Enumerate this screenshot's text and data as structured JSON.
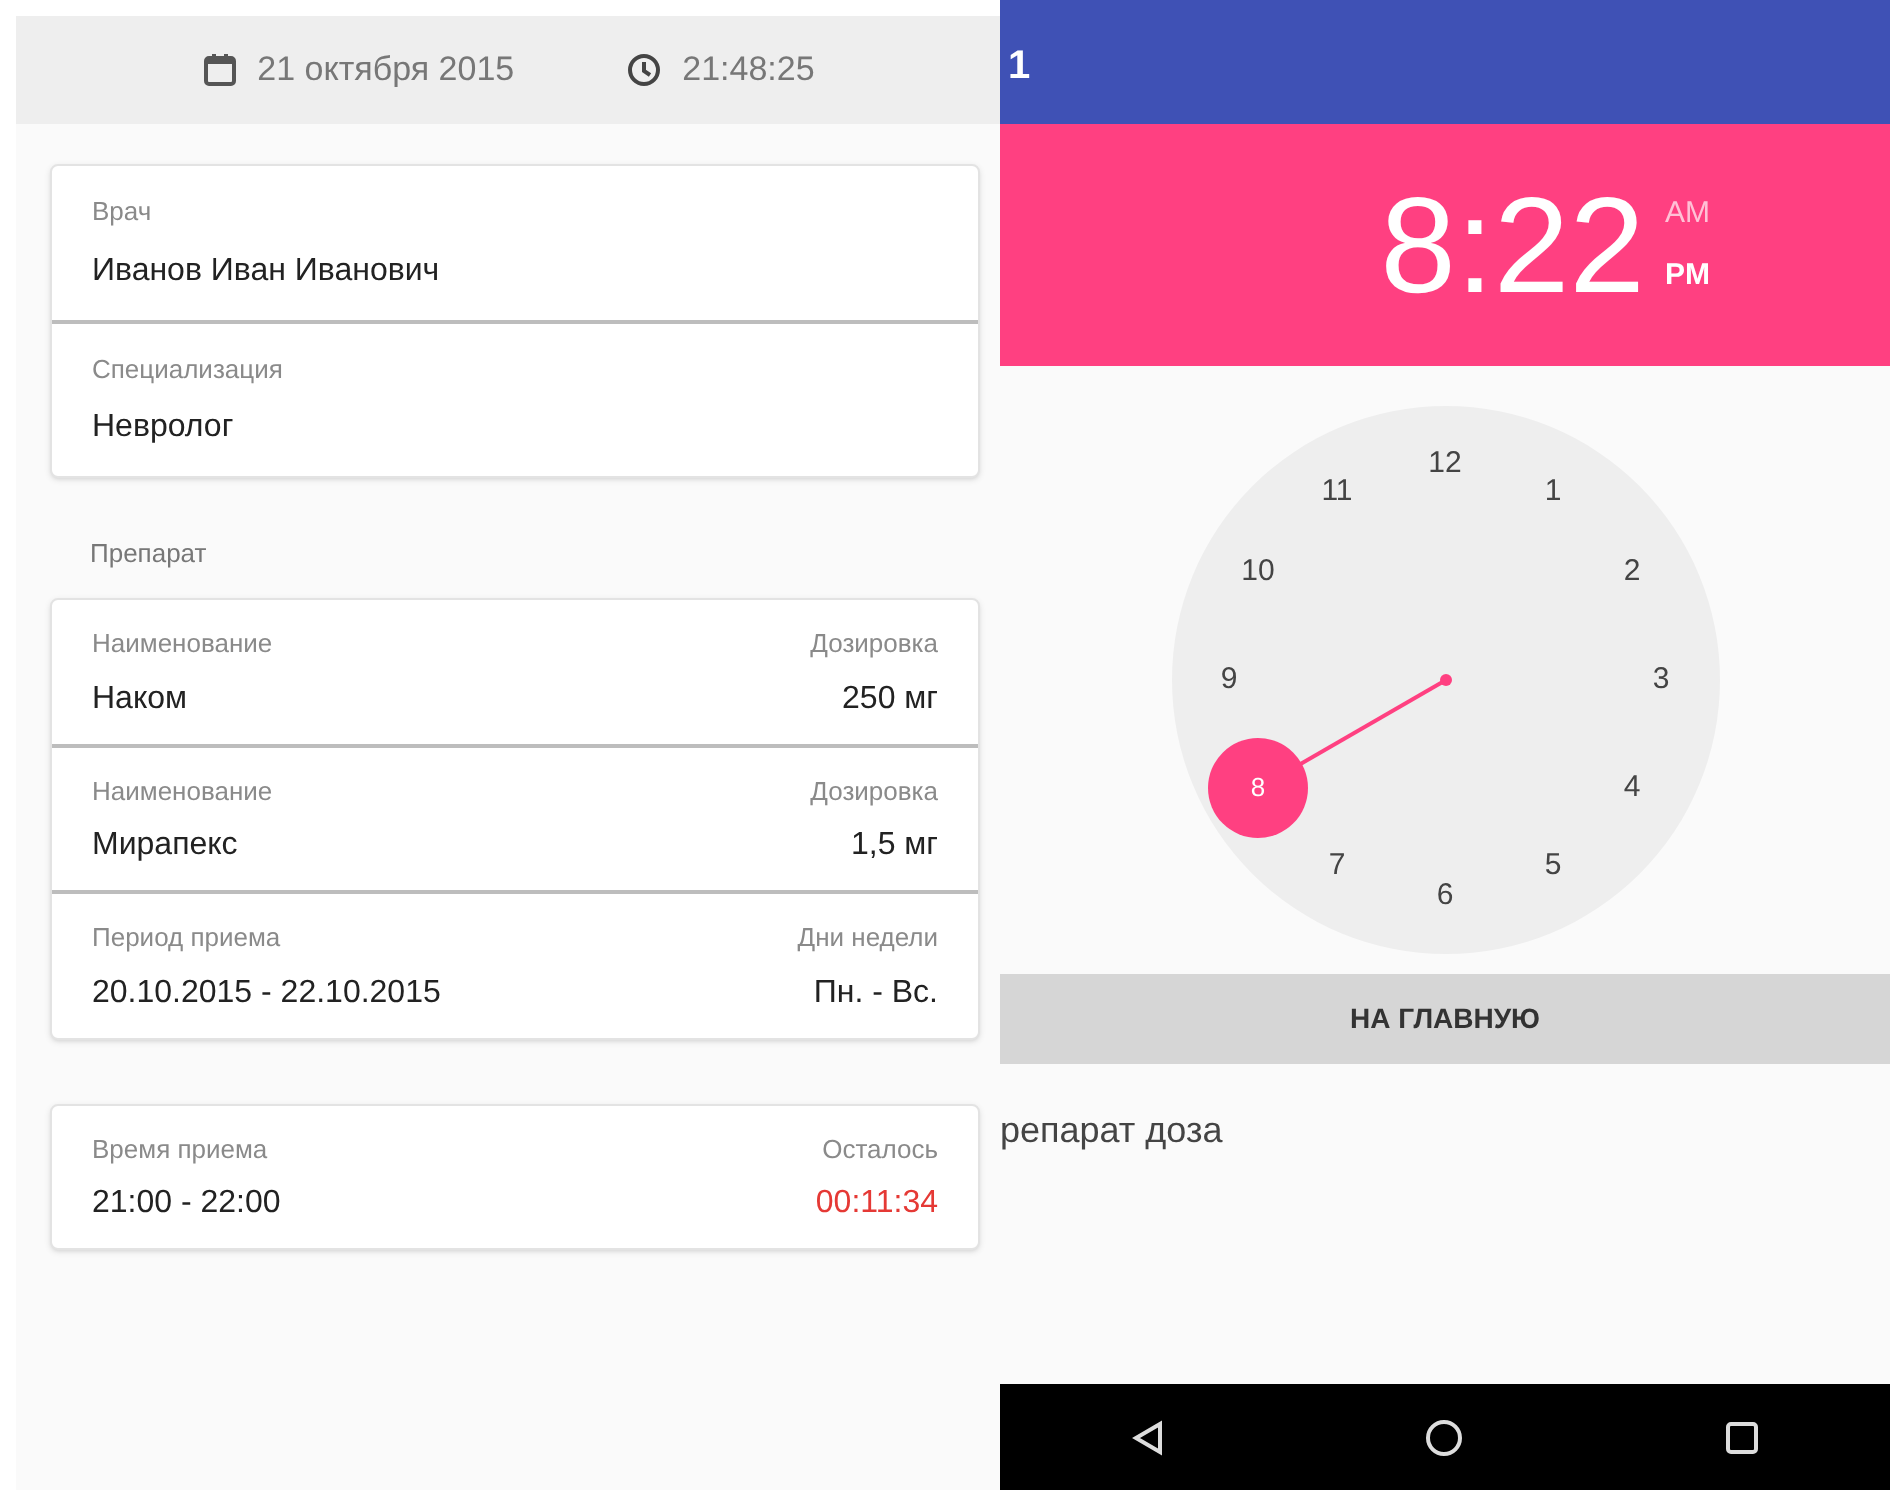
{
  "header": {
    "date": "21 октября 2015",
    "time": "21:48:25"
  },
  "doctor_card": {
    "fields": [
      {
        "label": "Врач",
        "value": "Иванов Иван Иванович"
      },
      {
        "label": "Специализация",
        "value": "Невролог"
      }
    ]
  },
  "drug_section": {
    "title": "Препарат",
    "rows": [
      {
        "left_label": "Наименование",
        "left_value": "Наком",
        "right_label": "Дозировка",
        "right_value": "250 мг"
      },
      {
        "left_label": "Наименование",
        "left_value": "Мирапекс",
        "right_label": "Дозировка",
        "right_value": "1,5 мг"
      },
      {
        "left_label": "Период приема",
        "left_value": "20.10.2015 - 22.10.2015",
        "right_label": "Дни недели",
        "right_value": "Пн. - Вс."
      }
    ]
  },
  "intake_card": {
    "left_label": "Время приема",
    "left_value": "21:00 - 22:00",
    "right_label": "Осталось",
    "right_value": "00:11:34"
  },
  "time_picker": {
    "status_bar_text": "1",
    "time": "8:22",
    "am_pm": [
      {
        "label": "AM",
        "selected": false
      },
      {
        "label": "PM",
        "selected": true
      }
    ],
    "dial": [
      {
        "label": "12",
        "selected": false
      },
      {
        "label": "1",
        "selected": false
      },
      {
        "label": "2",
        "selected": false
      },
      {
        "label": "3",
        "selected": false
      },
      {
        "label": "4",
        "selected": false
      },
      {
        "label": "5",
        "selected": false
      },
      {
        "label": "6",
        "selected": false
      },
      {
        "label": "7",
        "selected": false
      },
      {
        "label": "8",
        "selected": true
      },
      {
        "label": "9",
        "selected": false
      },
      {
        "label": "10",
        "selected": false
      },
      {
        "label": "11",
        "selected": false
      }
    ],
    "button": "НА ГЛАВНУЮ",
    "text": "репарат доза"
  }
}
